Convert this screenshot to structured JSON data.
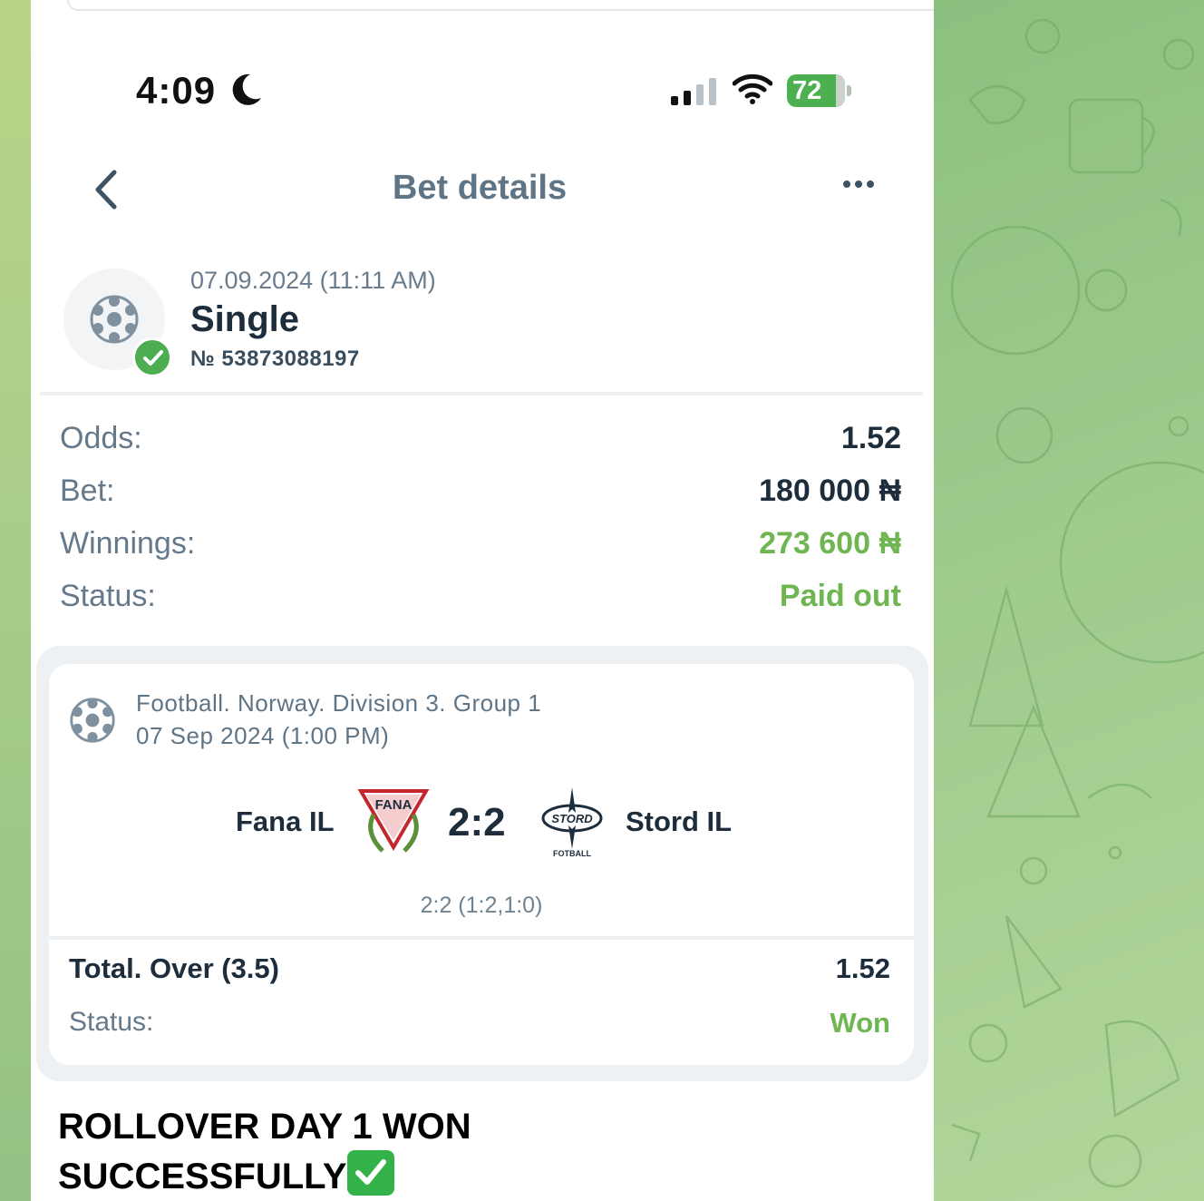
{
  "status_bar": {
    "time": "4:09",
    "battery": "72",
    "icons": [
      "moon-icon",
      "cellular-signal-icon",
      "wifi-icon",
      "battery-icon"
    ]
  },
  "nav": {
    "title": "Bet details",
    "back_icon": "chevron-left-icon",
    "more_icon": "more-horizontal-icon"
  },
  "bet": {
    "date": "07.09.2024 (11:11 AM)",
    "type": "Single",
    "number": "№ 53873088197"
  },
  "summary": {
    "odds_label": "Odds:",
    "odds_value": "1.52",
    "bet_label": "Bet:",
    "bet_value": "180 000 ₦",
    "winnings_label": "Winnings:",
    "winnings_value": "273 600 ₦",
    "status_label": "Status:",
    "status_value": "Paid out"
  },
  "event": {
    "league": "Football. Norway. Division 3. Group 1",
    "date": "07 Sep 2024 (1:00 PM)",
    "team1": "Fana IL",
    "team1_logo_text": "FANA",
    "score": "2:2",
    "team2": "Stord IL",
    "team2_logo_text": "STORD",
    "team2_logo_subtext": "FOTBALL",
    "detail_score": "2:2 (1:2,1:0)",
    "market": "Total. Over (3.5)",
    "market_odds": "1.52",
    "status_label": "Status:",
    "status_value": "Won"
  },
  "caption": {
    "line1": "ROLLOVER DAY 1 WON",
    "line2": "SUCCESSFULLY"
  },
  "colors": {
    "accent_green": "#6fb552",
    "text_dark": "#1d2d3b",
    "text_muted": "#66798a"
  }
}
